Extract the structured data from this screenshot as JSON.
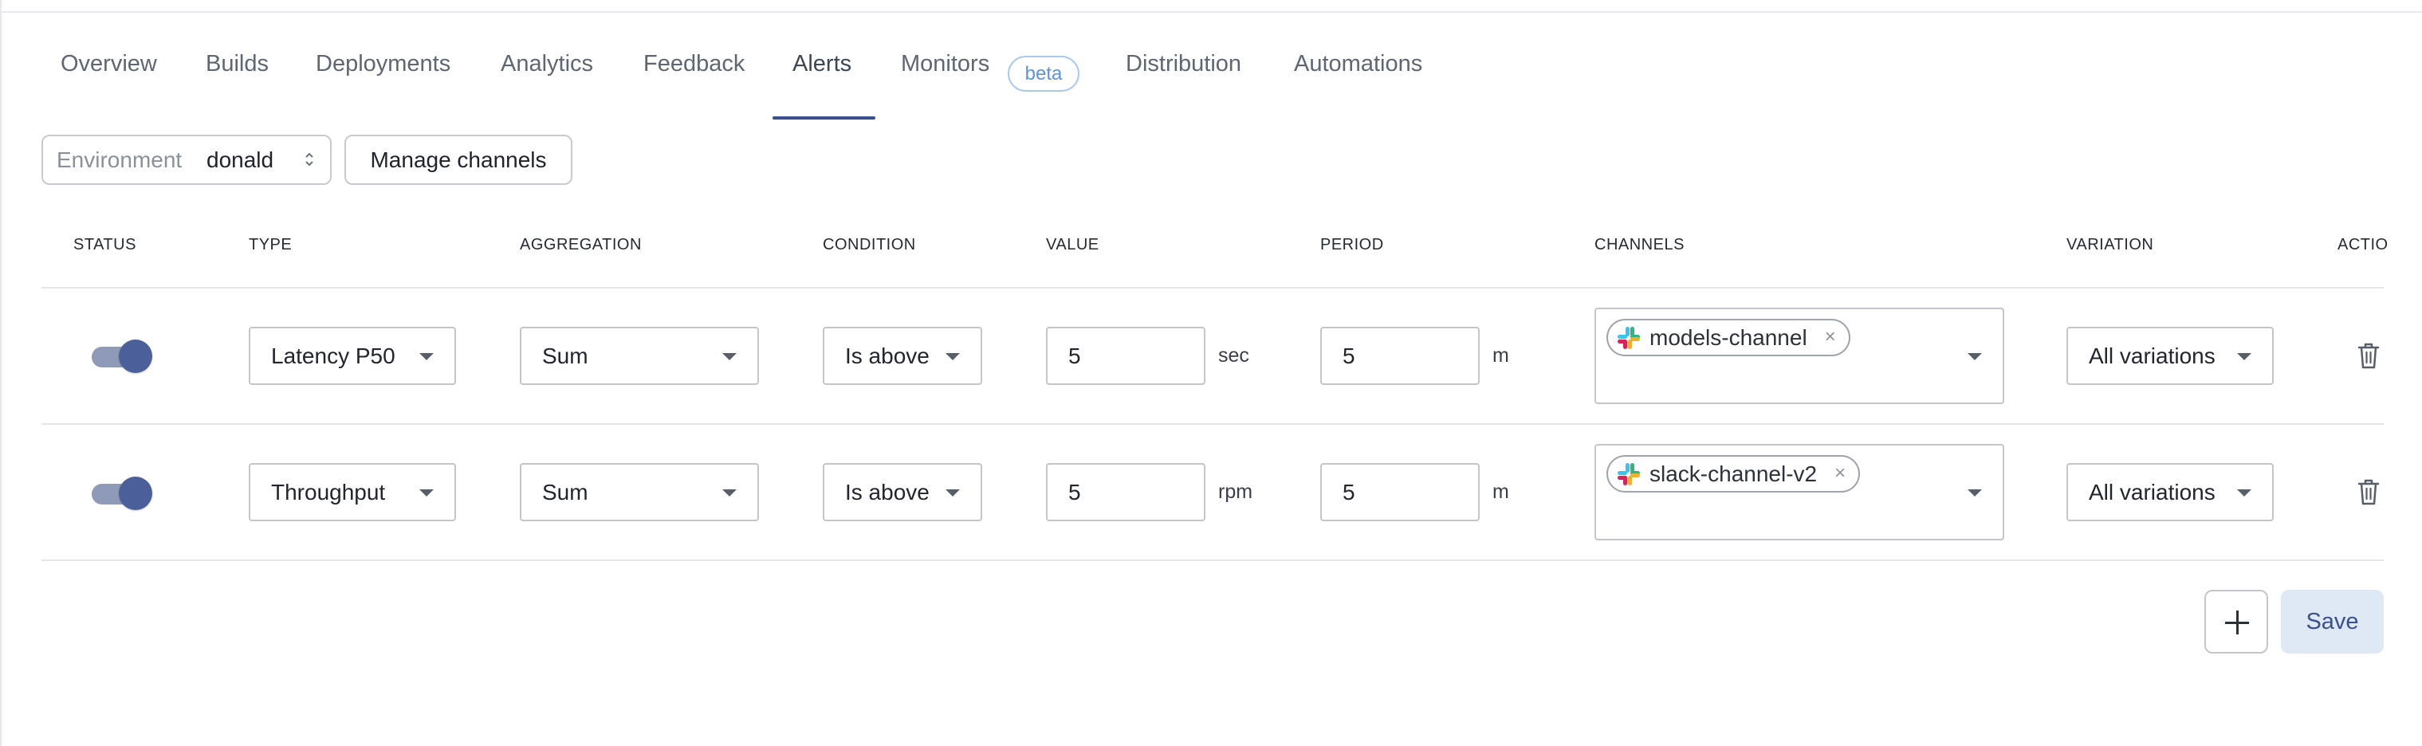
{
  "tabs": [
    {
      "label": "Overview"
    },
    {
      "label": "Builds"
    },
    {
      "label": "Deployments"
    },
    {
      "label": "Analytics"
    },
    {
      "label": "Feedback"
    },
    {
      "label": "Alerts",
      "active": true
    },
    {
      "label": "Monitors",
      "badge": "beta"
    },
    {
      "label": "Distribution"
    },
    {
      "label": "Automations"
    }
  ],
  "environment": {
    "label": "Environment",
    "value": "donald"
  },
  "manage_channels_label": "Manage channels",
  "columns": {
    "status": "STATUS",
    "type": "TYPE",
    "aggregation": "AGGREGATION",
    "condition": "CONDITION",
    "value": "VALUE",
    "period": "PERIOD",
    "channels": "CHANNELS",
    "variation": "VARIATION",
    "actions": "ACTIONS"
  },
  "alerts": [
    {
      "status_on": true,
      "type": "Latency P50",
      "aggregation": "Sum",
      "condition": "Is above",
      "value": "5",
      "value_unit": "sec",
      "period": "5",
      "period_unit": "m",
      "channel": "models-channel",
      "variation": "All variations"
    },
    {
      "status_on": true,
      "type": "Throughput",
      "aggregation": "Sum",
      "condition": "Is above",
      "value": "5",
      "value_unit": "rpm",
      "period": "5",
      "period_unit": "m",
      "channel": "slack-channel-v2",
      "variation": "All variations"
    }
  ],
  "add_icon": "plus-icon",
  "save_label": "Save",
  "colors": {
    "accent": "#3b4f91",
    "toggle_on": "#4b5f9a",
    "badge": "#5b93dc",
    "save_bg": "#dfe8f5"
  }
}
